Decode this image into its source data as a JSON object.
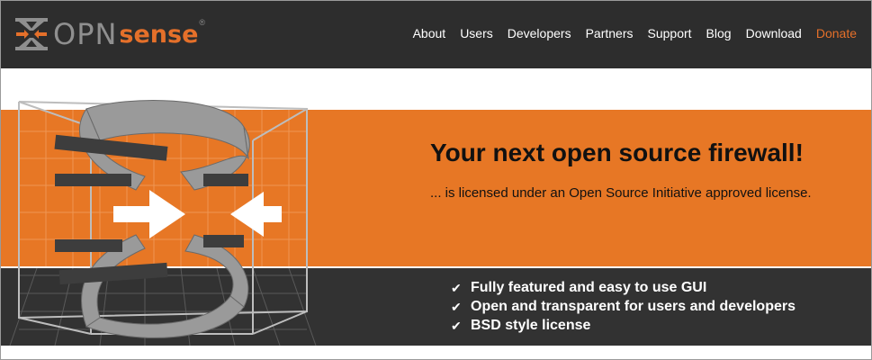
{
  "header": {
    "logo_icon": "opnsense-arrows-logo-icon",
    "brand_open": "OPN",
    "brand_sense": "sense",
    "registered": "®"
  },
  "nav": {
    "items": [
      "About",
      "Users",
      "Developers",
      "Partners",
      "Support",
      "Blog",
      "Download",
      "Donate"
    ]
  },
  "hero": {
    "headline": "Your next open source firewall!",
    "subline": "... is licensed under an Open Source Initiative approved license.",
    "features": [
      "Fully featured and easy to use GUI",
      "Open and transparent for users and developers",
      "BSD style license"
    ],
    "check_icon": "check-icon"
  },
  "colors": {
    "accent": "#e5702a",
    "band_orange": "#e77725",
    "dark": "#2d2d2d"
  }
}
